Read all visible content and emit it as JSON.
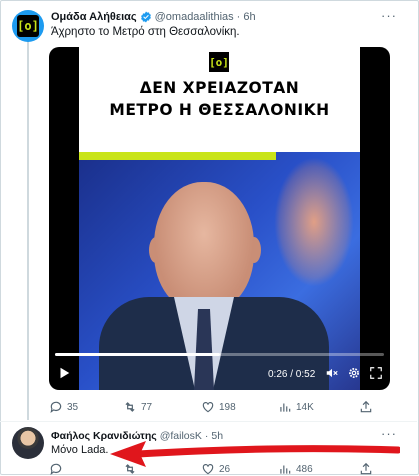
{
  "tweet1": {
    "name": "Ομάδα Αλήθειας",
    "handle": "@omadaalithias",
    "dot": "·",
    "time": "6h",
    "text": "Άχρηστο το Μετρό στη Θεσσαλονίκη.",
    "more": "···",
    "avatar_logo": "[ο]",
    "video": {
      "logo": "[ο]",
      "title_line1": "ΔΕΝ ΧΡΕΙΑΖΟΤΑΝ",
      "title_line2": "ΜΕΤΡΟ Η ΘΕΣΣΑΛΟΝΙΚΗ",
      "time_readout": "0:26 / 0:52",
      "progress_fraction": 0.5
    },
    "actions": {
      "replies": "35",
      "retweets": "77",
      "likes": "198",
      "views": "14K"
    }
  },
  "tweet2": {
    "name": "Φαήλος Κρανιδιώτης",
    "handle": "@failosK",
    "dot": "·",
    "time": "5h",
    "text": "Μόνο Lada.",
    "more": "···",
    "actions": {
      "replies": "",
      "retweets": "",
      "likes": "26",
      "views": "486"
    }
  },
  "colors": {
    "accent": "#1d9bf0",
    "brand_green": "#c9e419",
    "annotation_red": "#e0161c",
    "muted": "#536471"
  },
  "icons": {
    "reply": "reply-icon",
    "retweet": "retweet-icon",
    "like": "heart-icon",
    "views": "views-icon",
    "share": "share-icon",
    "verified": "verified-badge-icon"
  }
}
